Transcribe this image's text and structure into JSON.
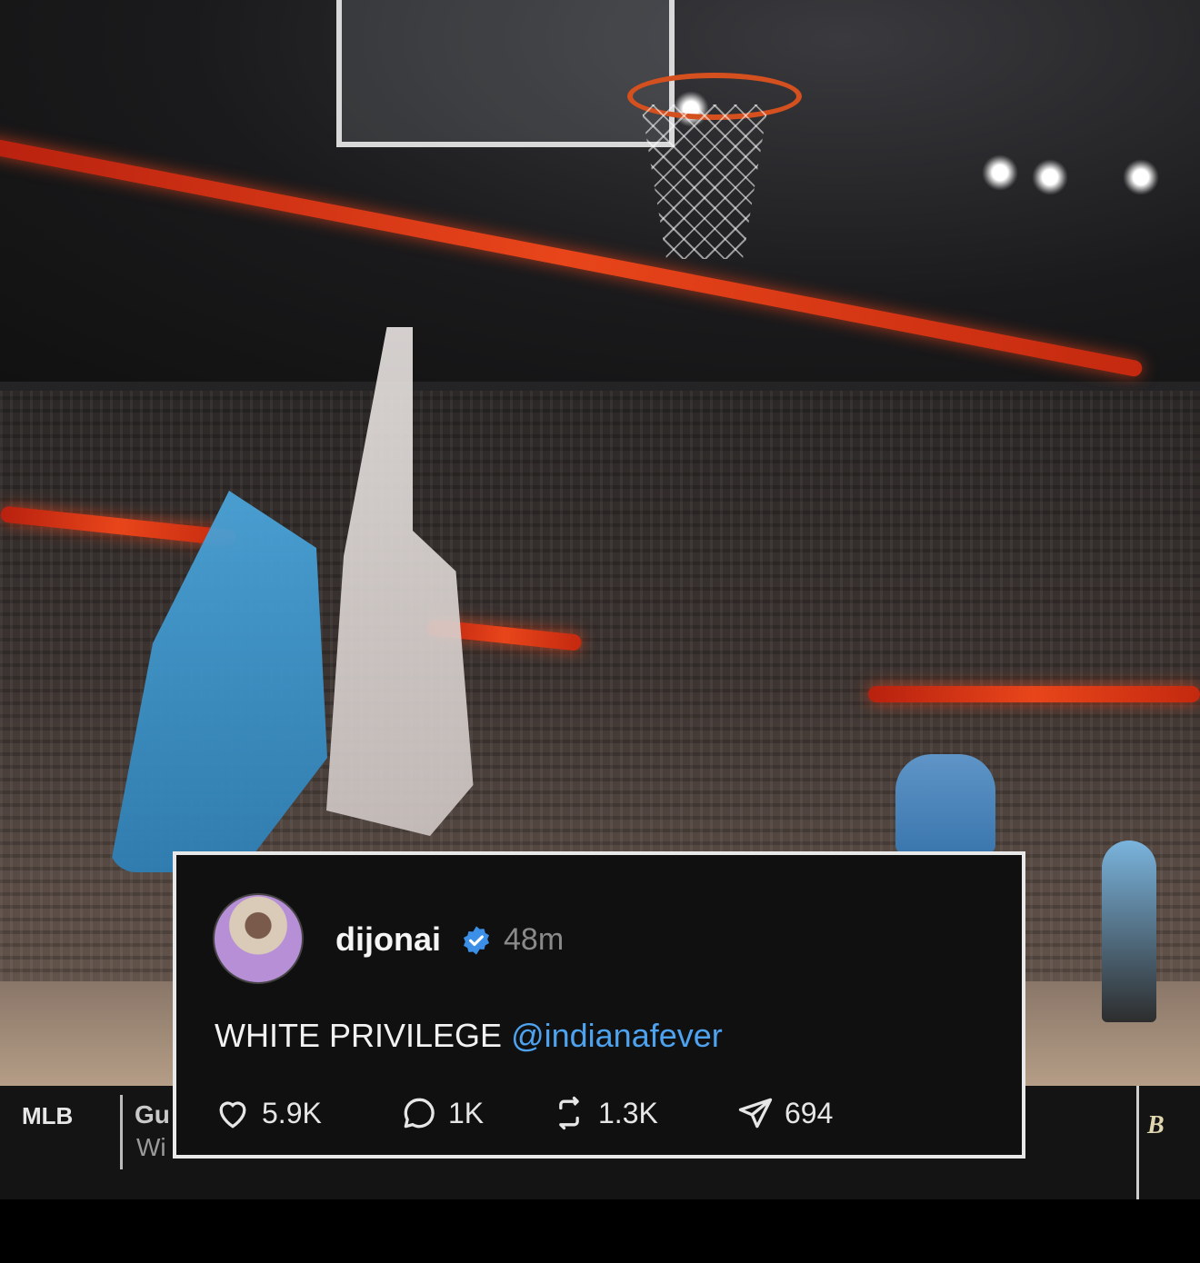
{
  "post": {
    "username": "dijonai",
    "time": "48m",
    "text": "WHITE PRIVILEGE ",
    "mention": "@indianafever",
    "likes": "5.9K",
    "comments": "1K",
    "reposts": "1.3K",
    "shares": "694"
  },
  "ticker": {
    "league": "MLB",
    "line1": "Gu",
    "line2": "Wi"
  },
  "colors": {
    "mention": "#4da3f0",
    "verified": "#3b8fe6"
  },
  "icons": {
    "like": "heart-icon",
    "comment": "comment-bubble-icon",
    "repost": "repost-icon",
    "share": "share-send-icon"
  }
}
